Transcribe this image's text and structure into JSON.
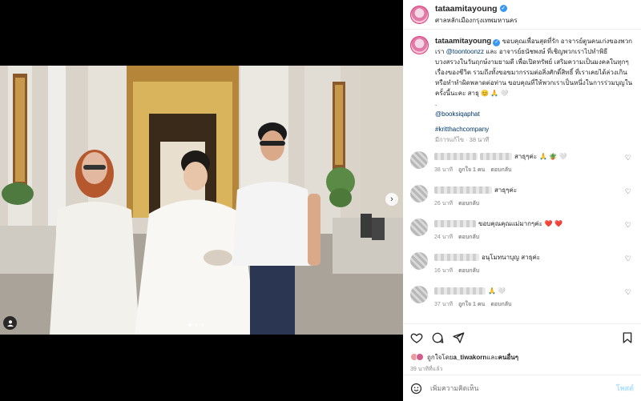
{
  "post": {
    "username": "tataamitayoung",
    "location": "ศาลหลักเมืองกรุงเทพมหานคร",
    "caption": {
      "username": "tataamitayoung",
      "text_before_mention": "ขอบคุณเพื่อนสุดที่รัก อาจารย์ตูนคนเก่งของพวกเรา ",
      "mention_1": "@toontoonzz",
      "text_after_mention": " และ อาจารย์ธนัชพงษ์ ที่เชิญพวกเราไปทำพิธี บวงสรวงในวันฤกษ์งามยามดี เพื่อเปิดทรัพย์ เสริมความเป็นมงคลในทุกๆ เรื่องของชีวิต รวมถึงทั้งขอขมากรรมต่อสิ่งศักดิ์สิทธิ์ ที่เราเคยได้ล่วงเกิน หรือทำทำผิดพลาดต่อท่าน ขอบคุณที่ให้พวกเราเป็นหนึ่งในการร่วมบุญในครั้งนี้นะคะ สาธุ 😊 🙏 🤍",
      "dot": ".",
      "mention_2": "@booksiqaphat",
      "hashtag": "#kritthachcompany",
      "edited": "มีการแก้ไข · 38 นาที"
    },
    "comments": [
      {
        "text": "สาธุๆค่ะ",
        "emojis": "🙏 🪴 🤍",
        "time": "38 นาที",
        "likes": "ถูกใจ 1 คน",
        "reply": "ตอบกลับ"
      },
      {
        "text": "สาธุๆค่ะ",
        "emojis": "",
        "time": "26 นาที",
        "likes": "",
        "reply": "ตอบกลับ"
      },
      {
        "text": "ขอบคุณคุณแม่มากๆค่ะ",
        "emojis": "❤️ ❤️",
        "time": "24 นาที",
        "likes": "",
        "reply": "ตอบกลับ"
      },
      {
        "text": "อนุโมทนาบุญ สาธุค่ะ",
        "emojis": "",
        "time": "16 นาที",
        "likes": "",
        "reply": "ตอบกลับ"
      },
      {
        "text": "",
        "emojis": "🙏 🤍",
        "time": "37 นาที",
        "likes": "ถูกใจ 1 คน",
        "reply": "ตอบกลับ"
      }
    ],
    "liked_by_prefix": "ถูกใจโดย ",
    "liked_by_user": "a_tiwakorn",
    "liked_by_suffix": " และ",
    "liked_by_others": "คนอื่นๆ",
    "posted_ago": "39 นาทีที่แล้ว",
    "comment_placeholder": "เพิ่มความคิดเห็น",
    "post_label": "โพสต์"
  },
  "icons": {
    "heart": "heart-icon",
    "comment": "comment-icon",
    "share": "share-icon",
    "bookmark": "bookmark-icon",
    "emoji": "emoji-icon",
    "next": "chevron-right-icon",
    "tag": "user-tag-icon"
  },
  "colors": {
    "accent": "#0095f6",
    "post_disabled": "#b2dffc",
    "verified": "#3897f0",
    "muted_text": "#8e8e8e"
  },
  "carousel": {
    "slides": 3,
    "current": 1
  }
}
